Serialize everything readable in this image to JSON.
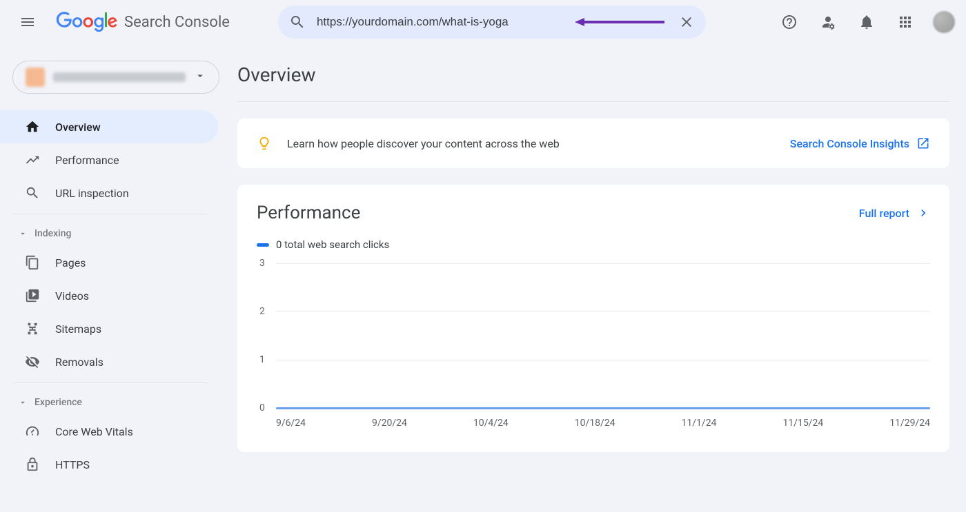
{
  "app_name": "Search Console",
  "search": {
    "value": "https://yourdomain.com/what-is-yoga"
  },
  "sidebar": {
    "items": [
      {
        "label": "Overview"
      },
      {
        "label": "Performance"
      },
      {
        "label": "URL inspection"
      }
    ],
    "sections": {
      "indexing": {
        "label": "Indexing",
        "items": [
          {
            "label": "Pages"
          },
          {
            "label": "Videos"
          },
          {
            "label": "Sitemaps"
          },
          {
            "label": "Removals"
          }
        ]
      },
      "experience": {
        "label": "Experience",
        "items": [
          {
            "label": "Core Web Vitals"
          },
          {
            "label": "HTTPS"
          }
        ]
      }
    }
  },
  "page": {
    "title": "Overview",
    "insights": {
      "text": "Learn how people discover your content across the web",
      "link_label": "Search Console Insights"
    },
    "performance": {
      "title": "Performance",
      "full_report_label": "Full report",
      "legend_text": "0 total web search clicks"
    }
  },
  "chart_data": {
    "type": "line",
    "title": "Performance",
    "ylabel": "clicks",
    "ylim": [
      0,
      3
    ],
    "yticks": [
      0,
      1,
      2,
      3
    ],
    "x": [
      "9/6/24",
      "9/20/24",
      "10/4/24",
      "10/18/24",
      "11/1/24",
      "11/15/24",
      "11/29/24"
    ],
    "series": [
      {
        "name": "total web search clicks",
        "color": "#1a73e8",
        "values": [
          0,
          0,
          0,
          0,
          0,
          0,
          0
        ]
      }
    ]
  }
}
